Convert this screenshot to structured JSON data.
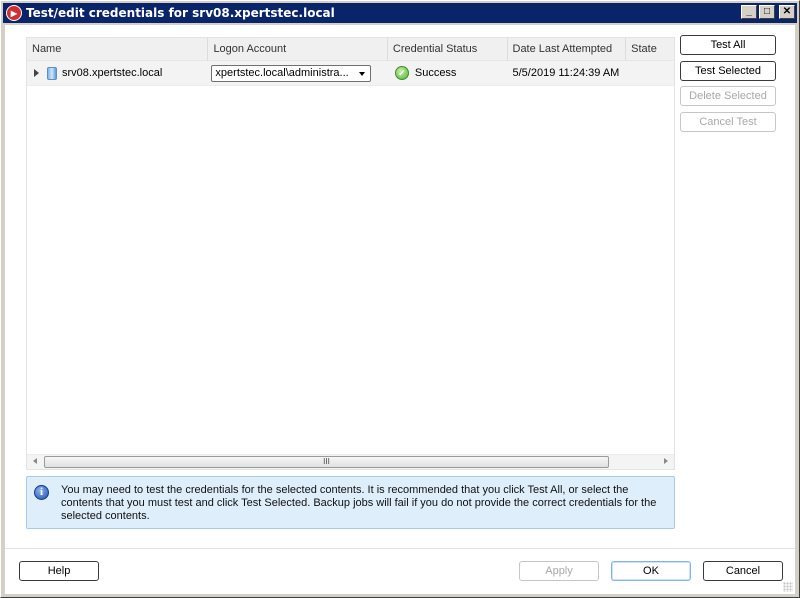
{
  "window": {
    "title": "Test/edit credentials for srv08.xpertstec.local",
    "controls": {
      "minimize": "_",
      "maximize": "□",
      "close": "✕"
    }
  },
  "grid": {
    "columns": [
      "Name",
      "Logon Account",
      "Credential Status",
      "Date Last Attempted",
      "State"
    ],
    "rows": [
      {
        "name": "srv08.xpertstec.local",
        "logon_account": "xpertstec.local\\administra...",
        "credential_status": "Success",
        "date_last_attempted": "5/5/2019 11:24:39 AM",
        "state": ""
      }
    ],
    "scroll_thumb_glyph": "III"
  },
  "side_buttons": {
    "test_all": "Test All",
    "test_selected": "Test Selected",
    "delete_selected": "Delete Selected",
    "cancel_test": "Cancel Test"
  },
  "info": {
    "icon": "i",
    "text": "You may need to test the credentials for the selected contents. It is recommended that you click Test All, or select the contents that you must test and click Test Selected. Backup jobs will fail if you do not provide the correct credentials for the selected contents."
  },
  "footer": {
    "help": "Help",
    "apply": "Apply",
    "ok": "OK",
    "cancel": "Cancel"
  }
}
